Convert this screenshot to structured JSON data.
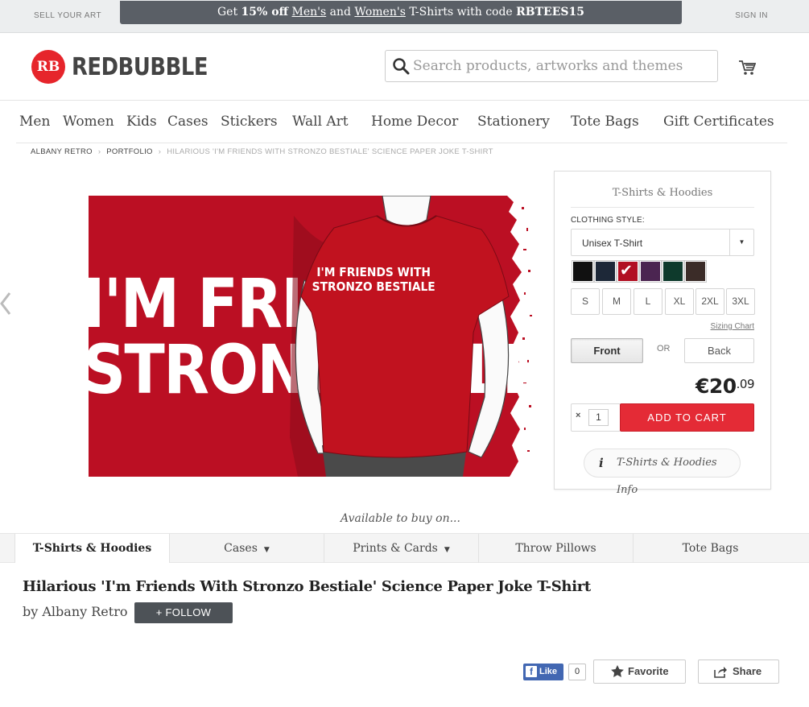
{
  "topbar": {
    "sell": "SELL YOUR ART",
    "signin": "SIGN IN",
    "promo": {
      "get": "Get ",
      "pct": "15% off",
      "sp1": " ",
      "mens": "Men's",
      "and": " and ",
      "womens": "Women's",
      "tail": " T-Shirts with code ",
      "code": "RBTEES15"
    }
  },
  "header": {
    "logo_mark": "RB",
    "logo_text": "REDBUBBLE",
    "search_placeholder": "Search products, artworks and themes"
  },
  "nav": [
    "Men",
    "Women",
    "Kids",
    "Cases",
    "Stickers",
    "Wall Art",
    "Home Decor",
    "Stationery",
    "Tote Bags",
    "Gift Certificates"
  ],
  "breadcrumb": [
    "ALBANY RETRO",
    "PORTFOLIO",
    "HILARIOUS 'I'M FRIENDS WITH STRONZO BESTIALE' SCIENCE PAPER JOKE T-SHIRT"
  ],
  "product_image": {
    "bg_text_line1": "I'M FRIEN",
    "bg_text_line2": "STRONZO B",
    "bg_text_right": "LE",
    "shirt_line1": "I'M FRIENDS WITH",
    "shirt_line2": "STRONZO BESTIALE",
    "color": "#bb0f23"
  },
  "panel": {
    "title": "T-Shirts & Hoodies",
    "style_label": "CLOTHING STYLE:",
    "style_value": "Unisex T-Shirt",
    "swatches": [
      "#111111",
      "#1d2838",
      "#b10f22",
      "#4b2551",
      "#0e3a2c",
      "#3b2c28"
    ],
    "selected_swatch": 2,
    "sizes": [
      "S",
      "M",
      "L",
      "XL",
      "2XL",
      "3XL"
    ],
    "sizing_chart": "Sizing Chart",
    "front": "Front",
    "or": "OR",
    "back": "Back",
    "price_main": "€20",
    "price_cents": ".09",
    "qty_x": "×",
    "qty": "1",
    "add_to_cart": "ADD TO CART",
    "info_icon": "i",
    "info": "T-Shirts & Hoodies Info"
  },
  "available": "Available to buy on...",
  "tabs": [
    {
      "label": "T-Shirts & Hoodies",
      "caret": ""
    },
    {
      "label": "Cases",
      "caret": "▼"
    },
    {
      "label": "Prints & Cards",
      "caret": "▼"
    },
    {
      "label": "Throw Pillows",
      "caret": ""
    },
    {
      "label": "Tote Bags",
      "caret": ""
    }
  ],
  "title": "Hilarious 'I'm Friends With Stronzo Bestiale' Science Paper Joke T-Shirt",
  "byline": "by Albany Retro",
  "follow": "+ FOLLOW",
  "social": {
    "like": "Like",
    "like_count": "0",
    "favorite": "Favorite",
    "share": "Share"
  },
  "colors": {
    "accent": "#e42b36",
    "brand": "#e6252b"
  }
}
